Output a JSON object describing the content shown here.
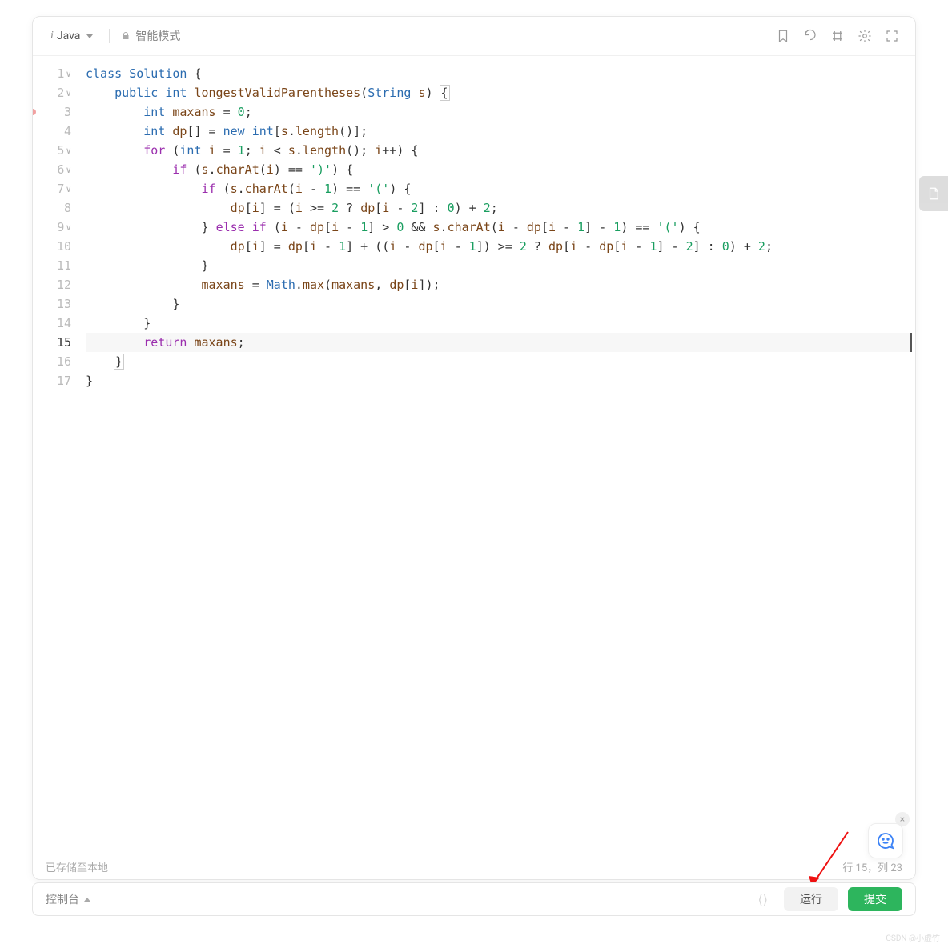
{
  "toolbar": {
    "language": "Java",
    "mode": "智能模式"
  },
  "status": {
    "saved": "已存储至本地",
    "cursor": "行 15，列 23"
  },
  "float_close": "×",
  "bottom": {
    "console": "控制台",
    "run": "运行",
    "submit": "提交"
  },
  "watermark": "CSDN @小虚竹",
  "editor": {
    "active_line": 15,
    "breakpoint_line": 3,
    "fold_lines": [
      1,
      2,
      5,
      6,
      7,
      9
    ],
    "lines": [
      {
        "n": 1,
        "html": "<span class='kw'>class</span> <span class='type'>Solution</span> {"
      },
      {
        "n": 2,
        "html": "    <span class='kw'>public</span> <span class='kw'>int</span> <span class='fn'>longestValidParentheses</span>(<span class='type'>String</span> <span class='name'>s</span>) <span class='bx'>{</span>"
      },
      {
        "n": 3,
        "html": "        <span class='kw'>int</span> <span class='name'>maxans</span> = <span class='num'>0</span>;"
      },
      {
        "n": 4,
        "html": "        <span class='kw'>int</span> <span class='name'>dp</span>[] = <span class='kw'>new</span> <span class='kw'>int</span>[<span class='name'>s</span>.<span class='fn'>length</span>()];"
      },
      {
        "n": 5,
        "html": "        <span class='kw2'>for</span> (<span class='kw'>int</span> <span class='name'>i</span> = <span class='num'>1</span>; <span class='name'>i</span> &lt; <span class='name'>s</span>.<span class='fn'>length</span>(); <span class='name'>i</span>++) {"
      },
      {
        "n": 6,
        "html": "            <span class='kw2'>if</span> (<span class='name'>s</span>.<span class='fn'>charAt</span>(<span class='name'>i</span>) == <span class='str'>')'</span>) {"
      },
      {
        "n": 7,
        "html": "                <span class='kw2'>if</span> (<span class='name'>s</span>.<span class='fn'>charAt</span>(<span class='name'>i</span> - <span class='num'>1</span>) == <span class='str'>'('</span>) {"
      },
      {
        "n": 8,
        "html": "                    <span class='name'>dp</span>[<span class='name'>i</span>] = (<span class='name'>i</span> &gt;= <span class='num'>2</span> ? <span class='name'>dp</span>[<span class='name'>i</span> - <span class='num'>2</span>] : <span class='num'>0</span>) + <span class='num'>2</span>;"
      },
      {
        "n": 9,
        "html": "                } <span class='kw2'>else</span> <span class='kw2'>if</span> (<span class='name'>i</span> - <span class='name'>dp</span>[<span class='name'>i</span> - <span class='num'>1</span>] &gt; <span class='num'>0</span> &amp;&amp; <span class='name'>s</span>.<span class='fn'>charAt</span>(<span class='name'>i</span> - <span class='name'>dp</span>[<span class='name'>i</span> - <span class='num'>1</span>] - <span class='num'>1</span>) == <span class='str'>'('</span>) {"
      },
      {
        "n": 10,
        "html": "                    <span class='name'>dp</span>[<span class='name'>i</span>] = <span class='name'>dp</span>[<span class='name'>i</span> - <span class='num'>1</span>] + ((<span class='name'>i</span> - <span class='name'>dp</span>[<span class='name'>i</span> - <span class='num'>1</span>]) &gt;= <span class='num'>2</span> ? <span class='name'>dp</span>[<span class='name'>i</span> - <span class='name'>dp</span>[<span class='name'>i</span> - <span class='num'>1</span>] - <span class='num'>2</span>] : <span class='num'>0</span>) + <span class='num'>2</span>;"
      },
      {
        "n": 11,
        "html": "                }"
      },
      {
        "n": 12,
        "html": "                <span class='name'>maxans</span> = <span class='type'>Math</span>.<span class='fn'>max</span>(<span class='name'>maxans</span>, <span class='name'>dp</span>[<span class='name'>i</span>]);"
      },
      {
        "n": 13,
        "html": "            }"
      },
      {
        "n": 14,
        "html": "        }"
      },
      {
        "n": 15,
        "html": "        <span class='kw2'>return</span> <span class='name'>maxans</span>;"
      },
      {
        "n": 16,
        "html": "    <span class='bx'>}</span>"
      },
      {
        "n": 17,
        "html": "}"
      }
    ]
  }
}
